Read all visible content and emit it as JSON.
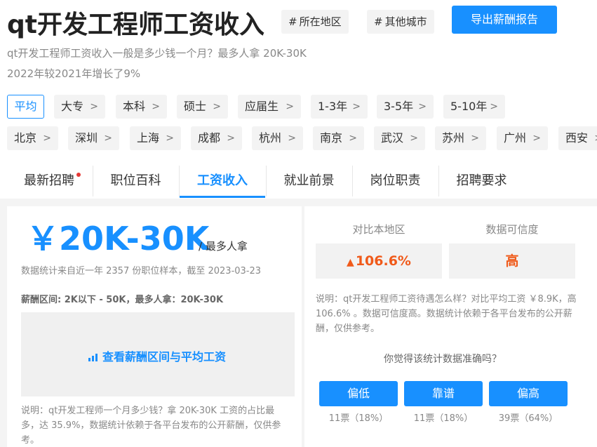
{
  "header": {
    "title": "qt开发工程师工资收入",
    "tags": [
      "所在地区",
      "其他城市"
    ],
    "export_label": "导出薪酬报告"
  },
  "summary": {
    "line1": "qt开发工程师工资收入一般是多少钱一个月？最多人拿 20K-30K",
    "line2": "2022年较2021年增长了9%"
  },
  "filters": {
    "levels": [
      "平均",
      "大专",
      "本科",
      "硕士",
      "应届生",
      "1-3年",
      "3-5年",
      "5-10年"
    ],
    "cities": [
      "北京",
      "深圳",
      "上海",
      "成都",
      "杭州",
      "南京",
      "武汉",
      "苏州",
      "广州",
      "西安"
    ]
  },
  "tabs": [
    "最新招聘",
    "职位百科",
    "工资收入",
    "就业前景",
    "岗位职责",
    "招聘要求"
  ],
  "salary": {
    "amount": "￥20K-30K",
    "unit": "/ 最多人拿",
    "stats": "数据统计来自近一年 2357 份职位样本，截至 2023-03-23",
    "range": "薪酬区间: 2K以下 - 50K，最多人拿：20K-30K",
    "view_link": "查看薪酬区间与平均工资",
    "note": "说明：qt开发工程师一个月多少钱？拿 20K-30K 工资的占比最多，达 35.9%，数据统计依赖于各平台发布的公开薪酬，仅供参考。"
  },
  "compare": {
    "local_label": "对比本地区",
    "local_value": "106.6%",
    "credibility_label": "数据可信度",
    "credibility_value": "高",
    "note": "说明：qt开发工程师工资待遇怎么样？对比平均工资 ￥8.9K，高 106.6% 。数据可信度高。数据统计依赖于各平台发布的公开薪酬，仅供参考。"
  },
  "vote": {
    "question": "你觉得该统计数据准确吗？",
    "options": [
      {
        "label": "偏低",
        "count": "11票（18%）"
      },
      {
        "label": "靠谱",
        "count": "11票（18%）"
      },
      {
        "label": "偏高",
        "count": "39票（64%）"
      }
    ]
  },
  "colors": {
    "accent": "#1890ff",
    "rise": "#f05a1a",
    "dot": "#e53935"
  }
}
